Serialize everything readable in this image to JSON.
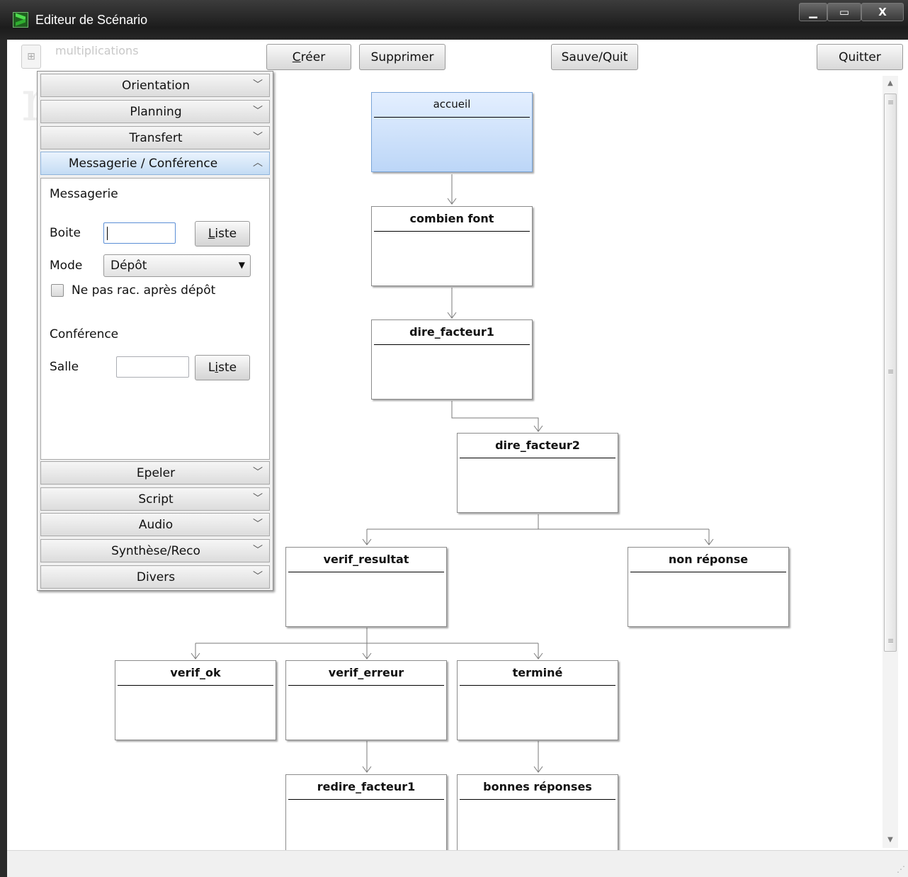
{
  "window": {
    "title": "Editeur de Scénario",
    "controls": {
      "minimize": "▁",
      "maximize": "▭",
      "close": "X"
    }
  },
  "toolbar": {
    "scenario_name": "multiplications",
    "creer_first": "C",
    "creer_rest": "réer",
    "supprimer": "Supprimer",
    "sauve_quit": "Sauve/Quit",
    "quitter": "Quitter"
  },
  "accordion": {
    "sections": [
      "Orientation",
      "Planning",
      "Transfert",
      "Messagerie / Conférence",
      "Epeler",
      "Script",
      "Audio",
      "Synthèse/Reco",
      "Divers"
    ],
    "open_section": "Messagerie / Conférence",
    "messagerie": {
      "heading": "Messagerie",
      "boite_label": "Boite",
      "boite_value": "",
      "liste_first": "L",
      "liste_rest": "iste",
      "mode_label": "Mode",
      "mode_value": "Dépôt",
      "checkbox_label": "Ne pas rac. après dépôt",
      "checkbox_checked": false
    },
    "conference": {
      "heading": "Conférence",
      "salle_label": "Salle",
      "salle_value": "",
      "liste_first": "L",
      "liste_mid": "i",
      "liste_rest": "ste"
    }
  },
  "nodes": [
    {
      "id": "accueil",
      "label": "accueil",
      "selected": true
    },
    {
      "id": "combien-font",
      "label": "combien font"
    },
    {
      "id": "dire-facteur1",
      "label": "dire_facteur1"
    },
    {
      "id": "dire-facteur2",
      "label": "dire_facteur2"
    },
    {
      "id": "verif-resultat",
      "label": "verif_resultat"
    },
    {
      "id": "non-reponse",
      "label": "non réponse"
    },
    {
      "id": "verif-ok",
      "label": "verif_ok"
    },
    {
      "id": "verif-erreur",
      "label": "verif_erreur"
    },
    {
      "id": "termine",
      "label": "terminé"
    },
    {
      "id": "redire-facteur1",
      "label": "redire_facteur1"
    },
    {
      "id": "bonnes-reponses",
      "label": "bonnes réponses"
    }
  ],
  "colors": {
    "selected_node": "#bcd6f7",
    "open_section": "#c4dcf4"
  }
}
